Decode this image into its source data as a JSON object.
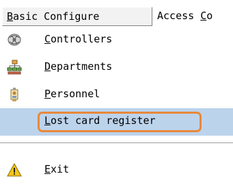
{
  "menubar": {
    "menus": [
      {
        "pre": "",
        "key": "B",
        "post": "asic Configure"
      },
      {
        "pre": "Access ",
        "key": "C",
        "post": "o"
      }
    ]
  },
  "dropdown": {
    "items": [
      {
        "key": "C",
        "rest": "ontrollers",
        "icon": "controllers-icon"
      },
      {
        "key": "D",
        "rest": "epartments",
        "icon": "departments-icon"
      },
      {
        "key": "P",
        "rest": "ersonnel",
        "icon": "personnel-icon"
      },
      {
        "key": "L",
        "rest": "ost card register",
        "icon": "",
        "selected": true
      },
      {
        "key": "E",
        "rest": "xit",
        "icon": "warning-icon"
      }
    ]
  },
  "colors": {
    "selection": "#bcd3ec",
    "highlight_outline": "#e8883a"
  }
}
